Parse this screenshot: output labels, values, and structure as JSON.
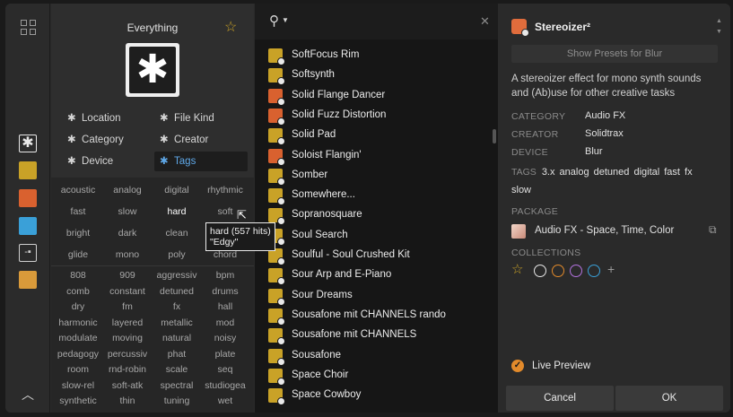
{
  "rail": {
    "items": [
      {
        "icon": "plugin-device-icon",
        "color": "#e8e8e8",
        "selected": true
      },
      {
        "icon": "instrument-icon",
        "color": "#c9a227"
      },
      {
        "icon": "audio-fx-icon",
        "color": "#d9612f"
      },
      {
        "icon": "note-fx-icon",
        "color": "#3aa0d8"
      },
      {
        "icon": "container-icon",
        "color": "#d0d0d0"
      },
      {
        "icon": "user-icon",
        "color": "#d99a3a"
      }
    ]
  },
  "filters": {
    "title": "Everything",
    "items": [
      {
        "label": "Location"
      },
      {
        "label": "File Kind"
      },
      {
        "label": "Category"
      },
      {
        "label": "Creator"
      },
      {
        "label": "Device"
      },
      {
        "label": "Tags",
        "active": true
      }
    ],
    "tag_rows_top": [
      [
        "acoustic",
        "analog",
        "digital",
        "rhythmic"
      ],
      [
        "fast",
        "slow",
        "hard",
        "soft"
      ],
      [
        "bright",
        "dark",
        "clean",
        "dirty"
      ],
      [
        "glide",
        "mono",
        "poly",
        "chord"
      ]
    ],
    "tag_rows_bottom": [
      [
        "808",
        "909",
        "aggressiv",
        "bpm"
      ],
      [
        "comb",
        "constant",
        "detuned",
        "drums"
      ],
      [
        "dry",
        "fm",
        "fx",
        "hall"
      ],
      [
        "harmonic",
        "layered",
        "metallic",
        "mod"
      ],
      [
        "modulate",
        "moving",
        "natural",
        "noisy"
      ],
      [
        "pedagogy",
        "percussiv",
        "phat",
        "plate"
      ],
      [
        "room",
        "rnd-robin",
        "scale",
        "seq"
      ],
      [
        "slow-rel",
        "soft-atk",
        "spectral",
        "studiogea"
      ],
      [
        "synthetic",
        "thin",
        "tuning",
        "wet"
      ]
    ],
    "tooltip": {
      "line1": "hard (557 hits)",
      "line2": "\"Edgy\""
    }
  },
  "results": {
    "items": [
      {
        "label": "SoftFocus Rim",
        "kind": "preset"
      },
      {
        "label": "Softsynth",
        "kind": "instrument"
      },
      {
        "label": "Solid Flange Dancer",
        "kind": "audio-fx"
      },
      {
        "label": "Solid Fuzz Distortion",
        "kind": "audio-fx"
      },
      {
        "label": "Solid Pad",
        "kind": "instrument"
      },
      {
        "label": "Soloist Flangin'",
        "kind": "audio-fx"
      },
      {
        "label": "Somber",
        "kind": "instrument"
      },
      {
        "label": "Somewhere...",
        "kind": "instrument"
      },
      {
        "label": "Sopranosquare",
        "kind": "instrument"
      },
      {
        "label": "Soul Search",
        "kind": "instrument"
      },
      {
        "label": "Soulful - Soul Crushed Kit",
        "kind": "drum"
      },
      {
        "label": "Sour Arp and E-Piano",
        "kind": "instrument"
      },
      {
        "label": "Sour Dreams",
        "kind": "instrument"
      },
      {
        "label": "Sousafone mit CHANNELS rando",
        "kind": "instrument"
      },
      {
        "label": "Sousafone mit CHANNELS",
        "kind": "instrument"
      },
      {
        "label": "Sousafone",
        "kind": "instrument"
      },
      {
        "label": "Space Choir",
        "kind": "instrument"
      },
      {
        "label": "Space Cowboy",
        "kind": "instrument"
      }
    ]
  },
  "detail": {
    "title": "Stereoizer²",
    "preset_button": "Show Presets for Blur",
    "description": "A stereoizer effect for mono synth sounds and (Ab)use for other creative tasks",
    "fields": [
      {
        "key": "CATEGORY",
        "value": "Audio FX"
      },
      {
        "key": "CREATOR",
        "value": "Solidtrax"
      },
      {
        "key": "DEVICE",
        "value": "Blur"
      }
    ],
    "tags_key": "TAGS",
    "tags_value": "3.x analog detuned digital fast fx slow",
    "package_key": "PACKAGE",
    "package_name": "Audio FX - Space, Time, Color",
    "collections_key": "COLLECTIONS",
    "collection_colors": [
      "#e8e8e8",
      "#e28a2b",
      "#b473e0",
      "#3aa0d8"
    ],
    "live_preview": "Live Preview",
    "cancel": "Cancel",
    "ok": "OK"
  }
}
